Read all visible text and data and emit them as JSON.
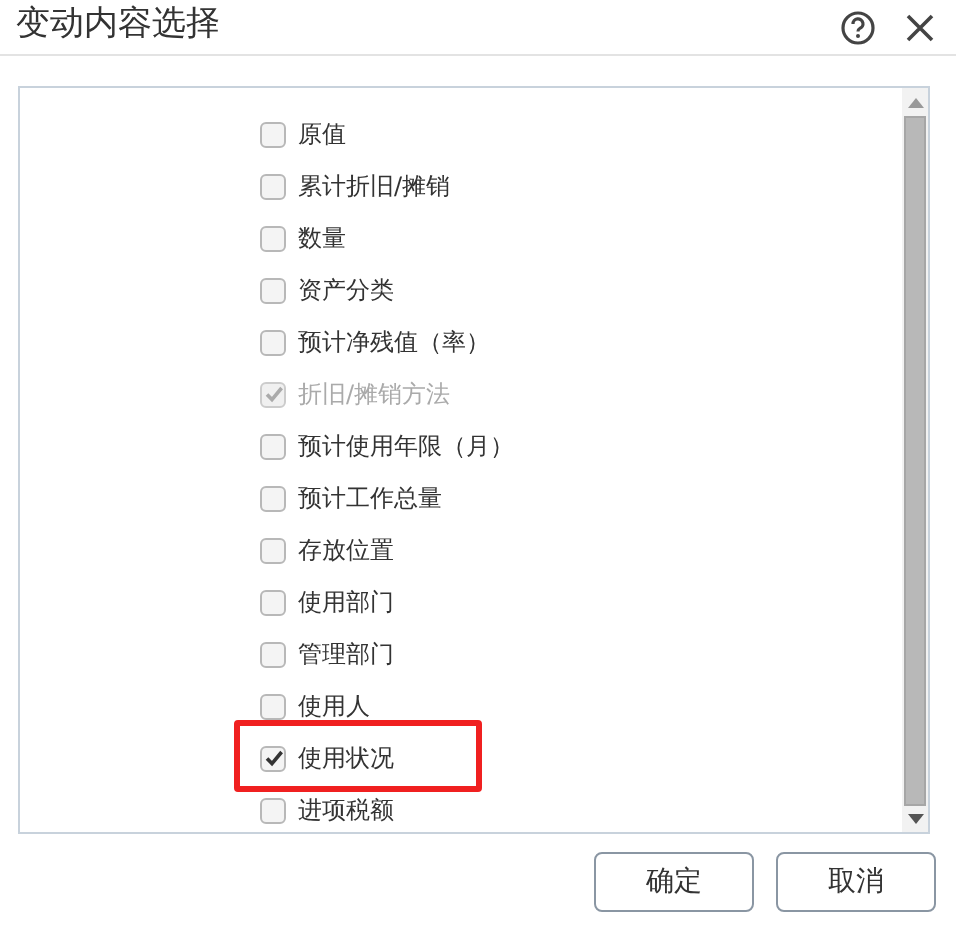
{
  "dialog": {
    "title": "变动内容选择"
  },
  "options": [
    {
      "label": "原值",
      "checked": false,
      "disabled": false,
      "highlighted": false
    },
    {
      "label": "累计折旧/摊销",
      "checked": false,
      "disabled": false,
      "highlighted": false
    },
    {
      "label": "数量",
      "checked": false,
      "disabled": false,
      "highlighted": false
    },
    {
      "label": "资产分类",
      "checked": false,
      "disabled": false,
      "highlighted": false
    },
    {
      "label": "预计净残值（率）",
      "checked": false,
      "disabled": false,
      "highlighted": false
    },
    {
      "label": "折旧/摊销方法",
      "checked": true,
      "disabled": true,
      "highlighted": false
    },
    {
      "label": "预计使用年限（月）",
      "checked": false,
      "disabled": false,
      "highlighted": false
    },
    {
      "label": "预计工作总量",
      "checked": false,
      "disabled": false,
      "highlighted": false
    },
    {
      "label": "存放位置",
      "checked": false,
      "disabled": false,
      "highlighted": false
    },
    {
      "label": "使用部门",
      "checked": false,
      "disabled": false,
      "highlighted": false
    },
    {
      "label": "管理部门",
      "checked": false,
      "disabled": false,
      "highlighted": false
    },
    {
      "label": "使用人",
      "checked": false,
      "disabled": false,
      "highlighted": false
    },
    {
      "label": "使用状况",
      "checked": true,
      "disabled": false,
      "highlighted": true
    },
    {
      "label": "进项税额",
      "checked": false,
      "disabled": false,
      "highlighted": false
    }
  ],
  "buttons": [
    "确定",
    "取消"
  ]
}
